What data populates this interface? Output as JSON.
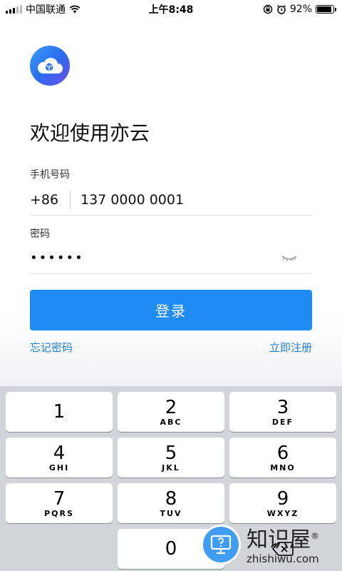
{
  "status_bar": {
    "carrier": "中国联通",
    "time": "上午8:48",
    "battery": "92%",
    "battery_level": 0.92
  },
  "app": {
    "logo_icon": "cloud-logo-icon",
    "welcome": "欢迎使用亦云"
  },
  "form": {
    "phone_label": "手机号码",
    "country_code": "+86",
    "phone_value": "137 0000 0001",
    "password_label": "密码",
    "password_value": "••••••",
    "eye_icon": "eye-closed-icon",
    "login_label": "登录",
    "forgot_label": "忘记密码",
    "register_label": "立即注册",
    "accent_color": "#1f8cf5"
  },
  "keypad": {
    "keys": [
      {
        "num": "1",
        "letters": ""
      },
      {
        "num": "2",
        "letters": "ABC"
      },
      {
        "num": "3",
        "letters": "DEF"
      },
      {
        "num": "4",
        "letters": "GHI"
      },
      {
        "num": "5",
        "letters": "JKL"
      },
      {
        "num": "6",
        "letters": "MNO"
      },
      {
        "num": "7",
        "letters": "PQRS"
      },
      {
        "num": "8",
        "letters": "TUV"
      },
      {
        "num": "9",
        "letters": "WXYZ"
      },
      {
        "num": "0",
        "letters": ""
      }
    ],
    "backspace_icon": "backspace-icon"
  },
  "watermark": {
    "cn": "知识屋",
    "en": "zhishiwu.com",
    "registered": "®"
  }
}
